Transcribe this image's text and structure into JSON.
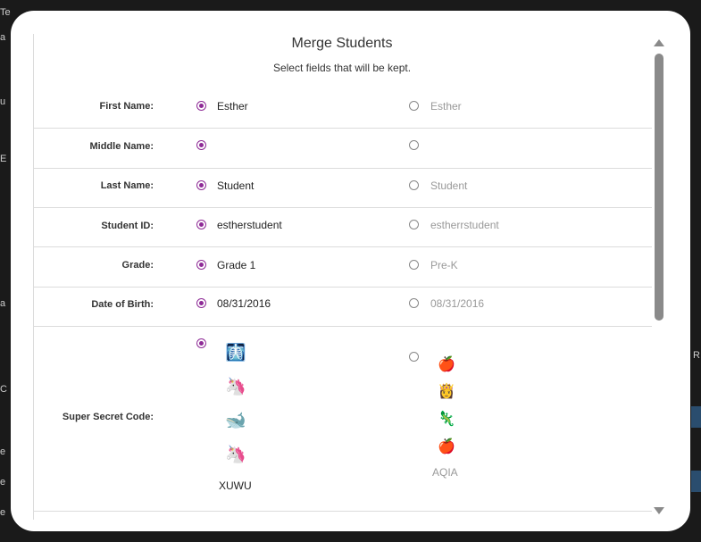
{
  "background": {
    "scraps": [
      "Te",
      "a",
      "u",
      "E",
      "a",
      "R",
      "C",
      "e",
      "e",
      "e"
    ]
  },
  "modal": {
    "title": "Merge Students",
    "subtitle": "Select fields that will be kept."
  },
  "rows": [
    {
      "label": "First Name:",
      "left": "Esther",
      "right": "Esther"
    },
    {
      "label": "Middle Name:",
      "left": "",
      "right": ""
    },
    {
      "label": "Last Name:",
      "left": "Student",
      "right": "Student"
    },
    {
      "label": "Student ID:",
      "left": "estherstudent",
      "right": "estherrstudent"
    },
    {
      "label": "Grade:",
      "left": "Grade 1",
      "right": "Pre-K"
    },
    {
      "label": "Date of Birth:",
      "left": "08/31/2016",
      "right": "08/31/2016"
    }
  ],
  "secret": {
    "label": "Super Secret Code:",
    "left_icons": [
      "🩻",
      "🦄",
      "🐋",
      "🦄"
    ],
    "left_code": "XUWU",
    "right_icons": [
      "🍎",
      "👸",
      "🦎",
      "🍎"
    ],
    "right_code": "AQIA"
  },
  "selection": {
    "left_selected": true,
    "right_selected": false
  },
  "colors": {
    "accent": "#8e2a96",
    "muted_text": "#999999",
    "divider": "#dcdcdc"
  }
}
